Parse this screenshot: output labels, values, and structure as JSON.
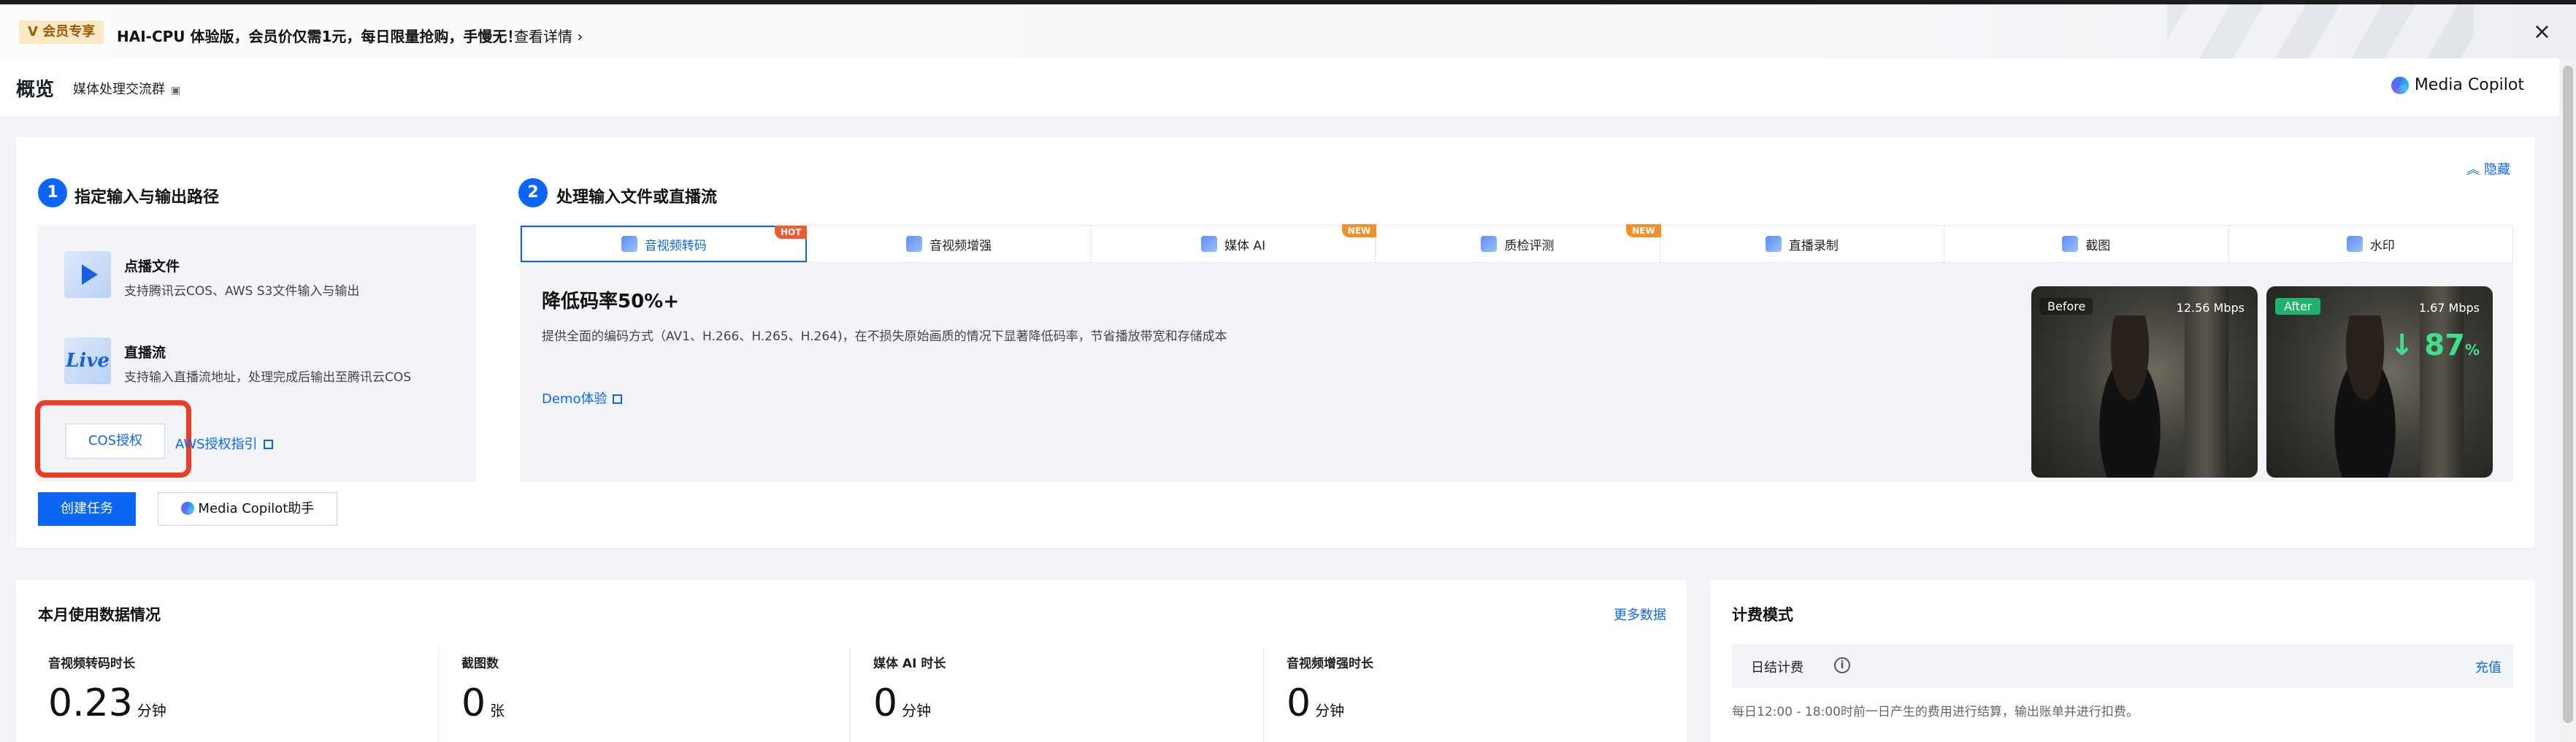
{
  "banner": {
    "member_tag": "V 会员专享",
    "promo": "HAI-CPU 体验版，会员价仅需1元，每日限量抢购，手慢无！",
    "details": "查看详情 ›",
    "close": "×"
  },
  "header": {
    "title": "概览",
    "group_link": "媒体处理交流群",
    "copilot": "Media Copilot"
  },
  "step1": {
    "num": "1",
    "title": "指定输入与输出路径",
    "sources": [
      {
        "title": "点播文件",
        "desc": "支持腾讯云COS、AWS S3文件输入与输出",
        "icon": "play-icon"
      },
      {
        "title": "直播流",
        "desc": "支持输入直播流地址，处理完成后输出至腾讯云COS",
        "icon_text": "Live"
      }
    ],
    "cos_auth": "COS授权",
    "aws_guide": "AWS授权指引"
  },
  "actions": {
    "create_task": "创建任务",
    "copilot_assistant": "Media Copilot助手"
  },
  "step2": {
    "num": "2",
    "title": "处理输入文件或直播流",
    "hide": "隐藏",
    "tabs": [
      {
        "label": "音视频转码",
        "badge": "HOT",
        "active": true
      },
      {
        "label": "音视频增强",
        "badge": ""
      },
      {
        "label": "媒体 AI",
        "badge": "NEW"
      },
      {
        "label": "质检评测",
        "badge": "NEW"
      },
      {
        "label": "直播录制",
        "badge": ""
      },
      {
        "label": "截图",
        "badge": ""
      },
      {
        "label": "水印",
        "badge": ""
      }
    ],
    "feature": {
      "title": "降低码率50%+",
      "desc": "提供全面的编码方式（AV1、H.266、H.265、H.264)，在不损失原始画质的情况下显著降低码率，节省播放带宽和存储成本",
      "demo": "Demo体验"
    },
    "before": {
      "tag": "Before",
      "rate": "12.56 Mbps"
    },
    "after": {
      "tag": "After",
      "rate": "1.67 Mbps",
      "pct": "87",
      "pct_unit": "%"
    }
  },
  "usage": {
    "title": "本月使用数据情况",
    "more": "更多数据",
    "metrics": [
      {
        "label": "音视频转码时长",
        "value": "0.23",
        "unit": "分钟"
      },
      {
        "label": "截图数",
        "value": "0",
        "unit": "张"
      },
      {
        "label": "媒体 AI 时长",
        "value": "0",
        "unit": "分钟"
      },
      {
        "label": "音视频增强时长",
        "value": "0",
        "unit": "分钟"
      }
    ]
  },
  "billing": {
    "title": "计费模式",
    "row_name": "日结计费",
    "charge": "充值",
    "note": "每日12:00 - 18:00时前一日产生的费用进行结算，输出账单并进行扣费。"
  },
  "colors": {
    "primary": "#0b66f5",
    "highlight": "#ee3b24",
    "hot": "#ee5b2e",
    "new": "#f2902c"
  }
}
